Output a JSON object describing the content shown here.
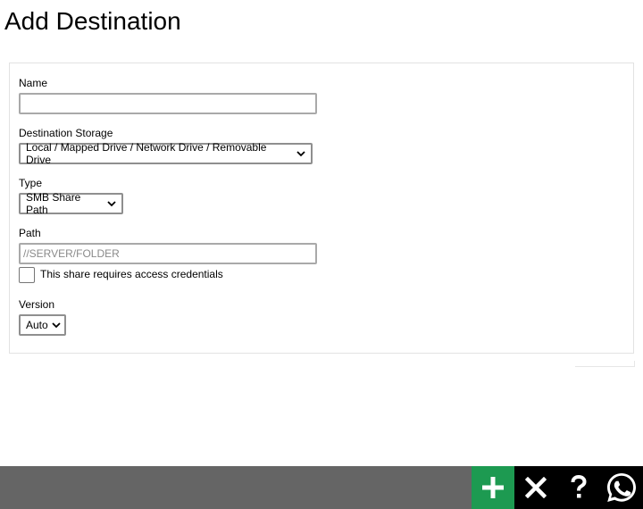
{
  "page": {
    "title": "Add Destination"
  },
  "form": {
    "name": {
      "label": "Name",
      "value": ""
    },
    "destination_storage": {
      "label": "Destination Storage",
      "selected": "Local / Mapped Drive / Network Drive / Removable Drive"
    },
    "type": {
      "label": "Type",
      "selected": "SMB Share Path"
    },
    "path": {
      "label": "Path",
      "placeholder": "//SERVER/FOLDER",
      "value": ""
    },
    "credentials": {
      "label": "This share requires access credentials",
      "checked": false
    },
    "version": {
      "label": "Version",
      "selected": "Auto"
    }
  },
  "toolbar": {
    "add_icon": "plus-icon",
    "close_icon": "close-x-icon",
    "help_icon": "question-mark-icon",
    "whatsapp_icon": "whatsapp-icon",
    "colors": {
      "bar": "#656565",
      "add": "#1d9a51",
      "dark": "#000000",
      "whatsapp": "#ffffff"
    }
  }
}
